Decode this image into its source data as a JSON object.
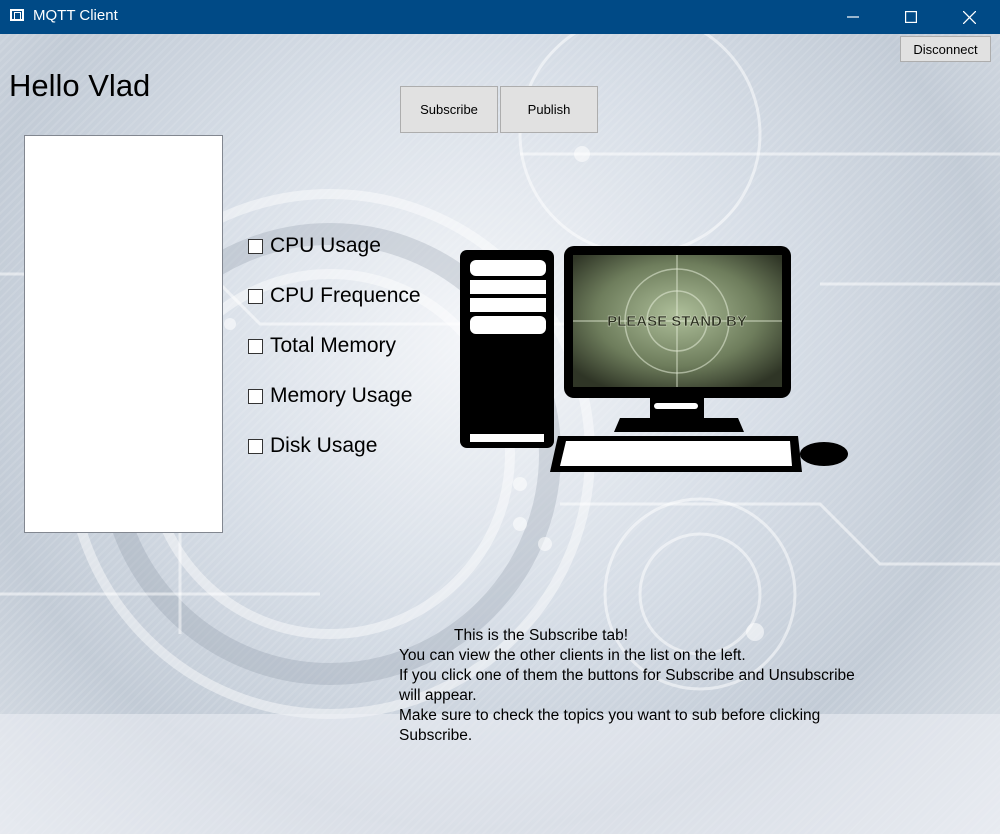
{
  "window": {
    "title": "MQTT Client",
    "controls": {
      "minimize": "minimize",
      "maximize": "maximize",
      "close": "close"
    }
  },
  "header": {
    "greeting": "Hello Vlad",
    "disconnect_label": "Disconnect"
  },
  "tabs": [
    {
      "label": "Subscribe"
    },
    {
      "label": "Publish"
    }
  ],
  "client_list": {
    "items": []
  },
  "topics": [
    {
      "label": "CPU Usage",
      "checked": false
    },
    {
      "label": "CPU Frequence",
      "checked": false
    },
    {
      "label": "Total Memory",
      "checked": false
    },
    {
      "label": "Memory Usage",
      "checked": false
    },
    {
      "label": "Disk Usage",
      "checked": false
    }
  ],
  "screen": {
    "text": "PLEASE STAND BY"
  },
  "info": {
    "lines": [
      "This is the Subscribe tab!",
      "You can view the other clients in the list on the left.",
      "If you click one of them the buttons for Subscribe and Unsubscribe",
      "will appear.",
      "Make sure to check the topics you want to sub before clicking",
      "Subscribe."
    ]
  },
  "colors": {
    "titlebar": "#004a86",
    "button_bg": "#e1e1e1",
    "list_bg": "#ffffff"
  }
}
